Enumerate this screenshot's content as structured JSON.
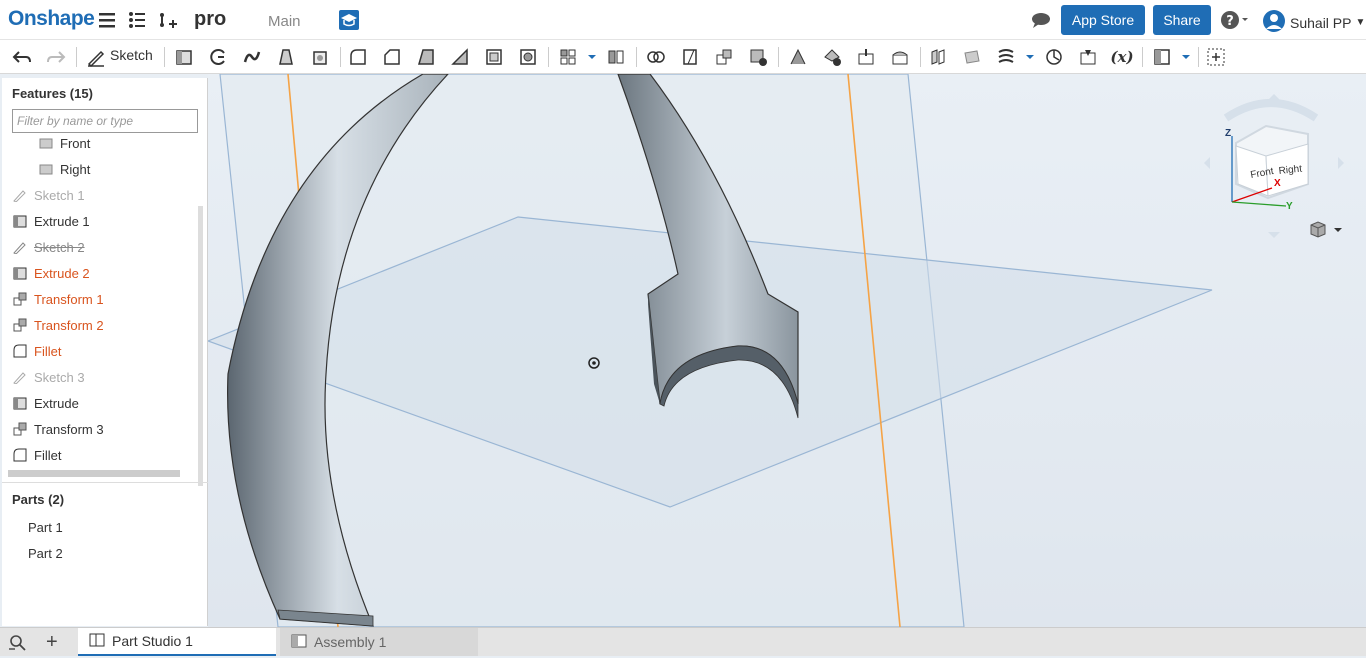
{
  "header": {
    "logo": "Onshape",
    "document_name": "pro",
    "workspace": "Main",
    "app_store_label": "App Store",
    "share_label": "Share",
    "user_name": "Suhail PP"
  },
  "toolbar": {
    "sketch_label": "Sketch",
    "variable_label": "(x)"
  },
  "features_panel": {
    "title": "Features (15)",
    "filter_placeholder": "Filter by name or type",
    "items": [
      {
        "label": "Front",
        "icon": "plane-icon",
        "state": "normal"
      },
      {
        "label": "Right",
        "icon": "plane-icon",
        "state": "normal"
      },
      {
        "label": "Sketch 1",
        "icon": "sketch-icon",
        "state": "hidden"
      },
      {
        "label": "Extrude 1",
        "icon": "extrude-icon",
        "state": "normal"
      },
      {
        "label": "Sketch 2",
        "icon": "sketch-icon",
        "state": "suppressed"
      },
      {
        "label": "Extrude 2",
        "icon": "extrude-icon",
        "state": "error"
      },
      {
        "label": "Transform 1",
        "icon": "transform-icon",
        "state": "error"
      },
      {
        "label": "Transform 2",
        "icon": "transform-icon",
        "state": "error"
      },
      {
        "label": "Fillet",
        "icon": "fillet-icon",
        "state": "error"
      },
      {
        "label": "Sketch 3",
        "icon": "sketch-icon",
        "state": "hidden"
      },
      {
        "label": "Extrude",
        "icon": "extrude-icon",
        "state": "normal"
      },
      {
        "label": "Transform 3",
        "icon": "transform-icon",
        "state": "normal"
      },
      {
        "label": "Fillet",
        "icon": "fillet-icon",
        "state": "normal"
      }
    ],
    "parts_title": "Parts (2)",
    "parts": [
      "Part 1",
      "Part 2"
    ]
  },
  "view_cube": {
    "front": "Front",
    "right": "Right",
    "axis_x": "X",
    "axis_y": "Y",
    "axis_z": "Z"
  },
  "tabs": [
    {
      "label": "Part Studio 1",
      "active": true
    },
    {
      "label": "Assembly 1",
      "active": false
    }
  ],
  "colors": {
    "brand": "#1f6db5",
    "error": "#d9541e",
    "plane": "#9ab6d4",
    "sketch_line": "#f5a346"
  }
}
